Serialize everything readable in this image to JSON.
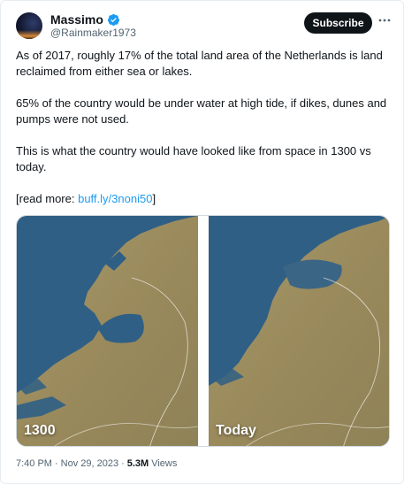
{
  "author": {
    "name": "Massimo",
    "handle": "@Rainmaker1973",
    "verified": true,
    "avatar_icon": "night-sky-avatar"
  },
  "actions": {
    "subscribe_label": "Subscribe",
    "more_icon": "more-horizontal-icon"
  },
  "tweet": {
    "paragraph1": "As of 2017, roughly 17% of the total land area of the Netherlands is land reclaimed from either sea or lakes.",
    "paragraph2": "65% of the country would be under water at high tide, if dikes, dunes and pumps were not used.",
    "paragraph3": "This is what the country would have looked like from space in 1300 vs today.",
    "read_more_prefix": "[read more: ",
    "read_more_link": "buff.ly/3noni50",
    "read_more_suffix": "]"
  },
  "media": {
    "left_label": "1300",
    "right_label": "Today"
  },
  "meta": {
    "time": "7:40 PM",
    "separator1": "·",
    "date": "Nov 29, 2023",
    "separator2": "·",
    "views_count": "5.3M",
    "views_label": "Views"
  },
  "colors": {
    "accent": "#1d9bf0",
    "sea": "#2f5f85",
    "land": "#a18f63",
    "text": "#0f1419",
    "muted": "#536471"
  }
}
